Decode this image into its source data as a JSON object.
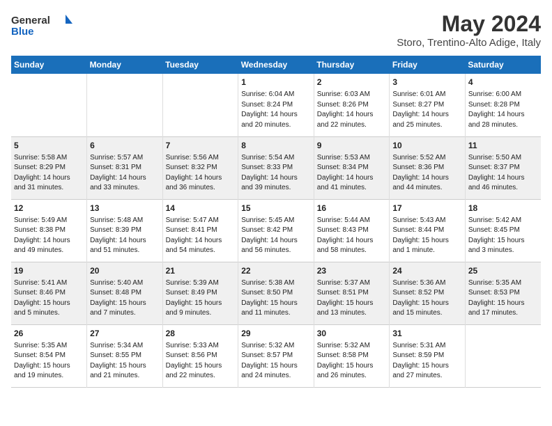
{
  "logo": {
    "general": "General",
    "blue": "Blue"
  },
  "title": "May 2024",
  "subtitle": "Storo, Trentino-Alto Adige, Italy",
  "days_header": [
    "Sunday",
    "Monday",
    "Tuesday",
    "Wednesday",
    "Thursday",
    "Friday",
    "Saturday"
  ],
  "weeks": [
    [
      {
        "day": "",
        "info": ""
      },
      {
        "day": "",
        "info": ""
      },
      {
        "day": "",
        "info": ""
      },
      {
        "day": "1",
        "info": "Sunrise: 6:04 AM\nSunset: 8:24 PM\nDaylight: 14 hours\nand 20 minutes."
      },
      {
        "day": "2",
        "info": "Sunrise: 6:03 AM\nSunset: 8:26 PM\nDaylight: 14 hours\nand 22 minutes."
      },
      {
        "day": "3",
        "info": "Sunrise: 6:01 AM\nSunset: 8:27 PM\nDaylight: 14 hours\nand 25 minutes."
      },
      {
        "day": "4",
        "info": "Sunrise: 6:00 AM\nSunset: 8:28 PM\nDaylight: 14 hours\nand 28 minutes."
      }
    ],
    [
      {
        "day": "5",
        "info": "Sunrise: 5:58 AM\nSunset: 8:29 PM\nDaylight: 14 hours\nand 31 minutes."
      },
      {
        "day": "6",
        "info": "Sunrise: 5:57 AM\nSunset: 8:31 PM\nDaylight: 14 hours\nand 33 minutes."
      },
      {
        "day": "7",
        "info": "Sunrise: 5:56 AM\nSunset: 8:32 PM\nDaylight: 14 hours\nand 36 minutes."
      },
      {
        "day": "8",
        "info": "Sunrise: 5:54 AM\nSunset: 8:33 PM\nDaylight: 14 hours\nand 39 minutes."
      },
      {
        "day": "9",
        "info": "Sunrise: 5:53 AM\nSunset: 8:34 PM\nDaylight: 14 hours\nand 41 minutes."
      },
      {
        "day": "10",
        "info": "Sunrise: 5:52 AM\nSunset: 8:36 PM\nDaylight: 14 hours\nand 44 minutes."
      },
      {
        "day": "11",
        "info": "Sunrise: 5:50 AM\nSunset: 8:37 PM\nDaylight: 14 hours\nand 46 minutes."
      }
    ],
    [
      {
        "day": "12",
        "info": "Sunrise: 5:49 AM\nSunset: 8:38 PM\nDaylight: 14 hours\nand 49 minutes."
      },
      {
        "day": "13",
        "info": "Sunrise: 5:48 AM\nSunset: 8:39 PM\nDaylight: 14 hours\nand 51 minutes."
      },
      {
        "day": "14",
        "info": "Sunrise: 5:47 AM\nSunset: 8:41 PM\nDaylight: 14 hours\nand 54 minutes."
      },
      {
        "day": "15",
        "info": "Sunrise: 5:45 AM\nSunset: 8:42 PM\nDaylight: 14 hours\nand 56 minutes."
      },
      {
        "day": "16",
        "info": "Sunrise: 5:44 AM\nSunset: 8:43 PM\nDaylight: 14 hours\nand 58 minutes."
      },
      {
        "day": "17",
        "info": "Sunrise: 5:43 AM\nSunset: 8:44 PM\nDaylight: 15 hours\nand 1 minute."
      },
      {
        "day": "18",
        "info": "Sunrise: 5:42 AM\nSunset: 8:45 PM\nDaylight: 15 hours\nand 3 minutes."
      }
    ],
    [
      {
        "day": "19",
        "info": "Sunrise: 5:41 AM\nSunset: 8:46 PM\nDaylight: 15 hours\nand 5 minutes."
      },
      {
        "day": "20",
        "info": "Sunrise: 5:40 AM\nSunset: 8:48 PM\nDaylight: 15 hours\nand 7 minutes."
      },
      {
        "day": "21",
        "info": "Sunrise: 5:39 AM\nSunset: 8:49 PM\nDaylight: 15 hours\nand 9 minutes."
      },
      {
        "day": "22",
        "info": "Sunrise: 5:38 AM\nSunset: 8:50 PM\nDaylight: 15 hours\nand 11 minutes."
      },
      {
        "day": "23",
        "info": "Sunrise: 5:37 AM\nSunset: 8:51 PM\nDaylight: 15 hours\nand 13 minutes."
      },
      {
        "day": "24",
        "info": "Sunrise: 5:36 AM\nSunset: 8:52 PM\nDaylight: 15 hours\nand 15 minutes."
      },
      {
        "day": "25",
        "info": "Sunrise: 5:35 AM\nSunset: 8:53 PM\nDaylight: 15 hours\nand 17 minutes."
      }
    ],
    [
      {
        "day": "26",
        "info": "Sunrise: 5:35 AM\nSunset: 8:54 PM\nDaylight: 15 hours\nand 19 minutes."
      },
      {
        "day": "27",
        "info": "Sunrise: 5:34 AM\nSunset: 8:55 PM\nDaylight: 15 hours\nand 21 minutes."
      },
      {
        "day": "28",
        "info": "Sunrise: 5:33 AM\nSunset: 8:56 PM\nDaylight: 15 hours\nand 22 minutes."
      },
      {
        "day": "29",
        "info": "Sunrise: 5:32 AM\nSunset: 8:57 PM\nDaylight: 15 hours\nand 24 minutes."
      },
      {
        "day": "30",
        "info": "Sunrise: 5:32 AM\nSunset: 8:58 PM\nDaylight: 15 hours\nand 26 minutes."
      },
      {
        "day": "31",
        "info": "Sunrise: 5:31 AM\nSunset: 8:59 PM\nDaylight: 15 hours\nand 27 minutes."
      },
      {
        "day": "",
        "info": ""
      }
    ]
  ]
}
